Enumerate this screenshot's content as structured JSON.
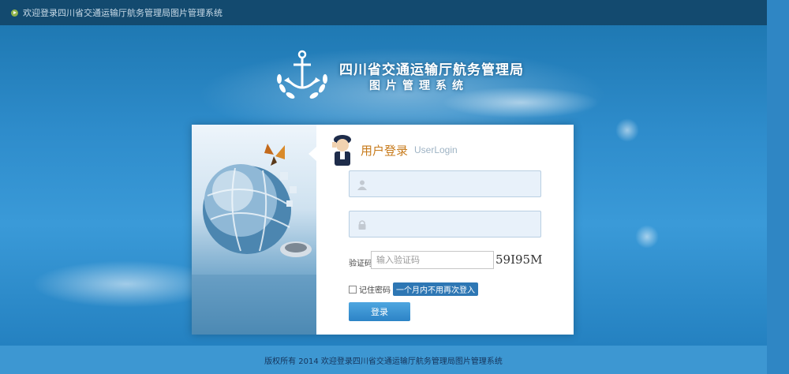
{
  "topbar": {
    "welcome_text": "欢迎登录四川省交通运输厅航务管理局图片管理系统"
  },
  "brand": {
    "title_line1": "四川省交通运输厅航务管理局",
    "title_line2": "图片管理系统"
  },
  "login": {
    "title": "用户登录",
    "subtitle": "UserLogin",
    "username": {
      "value": "",
      "placeholder": ""
    },
    "password": {
      "value": "",
      "placeholder": ""
    },
    "captcha_label": "验证码",
    "captcha_placeholder": "输入验证码",
    "captcha_code": "59I95M",
    "remember_label": "记住密码",
    "remember_tip": "一个月内不用再次登入",
    "remember_checked": false,
    "submit_label": "登录"
  },
  "footer": {
    "copyright": "版权所有 2014 欢迎登录四川省交通运输厅航务管理局图片管理系统"
  },
  "colors": {
    "topbar": "#134a6f",
    "accent": "#2e77b4",
    "title": "#c77a1a"
  },
  "icons": [
    "play-icon",
    "anchor-logo-icon",
    "officer-icon",
    "user-icon",
    "lock-icon",
    "globe-icon",
    "butterfly-icon",
    "mouse-icon"
  ]
}
